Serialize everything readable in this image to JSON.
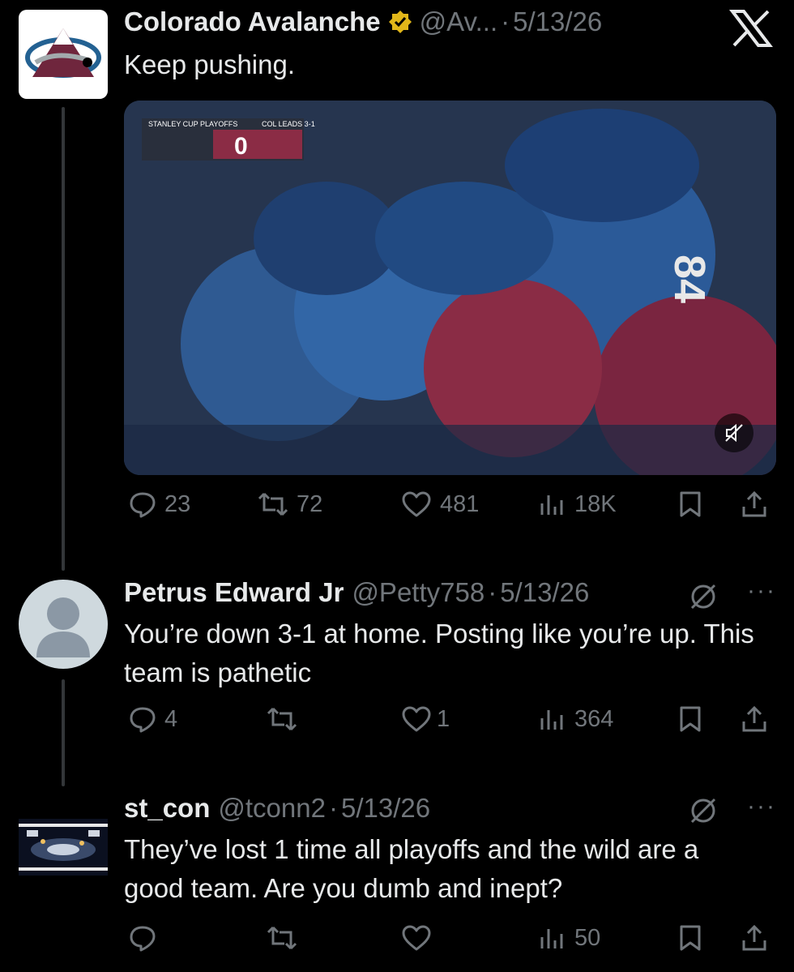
{
  "colors": {
    "background": "#000000",
    "text": "#e7e9ea",
    "secondary": "#71767b",
    "verified": "#e2b719"
  },
  "posts": [
    {
      "author": "Colorado Avalanche",
      "handle": "@Av...",
      "separator": "·",
      "date": "5/13/26",
      "verified_icon": "gold-verified-badge-icon",
      "text": "Keep pushing.",
      "media": {
        "score_bug_label": "STANLEY CUP PLAYOFFS",
        "series_text": "COL LEADS 3-1",
        "score": "0",
        "jersey_number": "84",
        "mute_icon": "speaker-muted-icon"
      },
      "stats": {
        "replies": "23",
        "reposts": "72",
        "likes": "481",
        "views": "18K"
      }
    },
    {
      "author": "Petrus Edward Jr",
      "handle": "@Petty758",
      "separator": "·",
      "date": "5/13/26",
      "text": "You’re down 3-1 at home. Posting like you’re up. This team is pathetic",
      "more": "···",
      "stats": {
        "replies": "4",
        "reposts": "",
        "likes": "1",
        "views": "364"
      }
    },
    {
      "author": "st_con",
      "handle": "@tconn2",
      "separator": "·",
      "date": "5/13/26",
      "text": "They’ve lost 1 time all playoffs and the wild are a good team. Are you dumb and inept?",
      "more": "···",
      "stats": {
        "replies": "",
        "reposts": "",
        "likes": "",
        "views": "50"
      }
    }
  ]
}
